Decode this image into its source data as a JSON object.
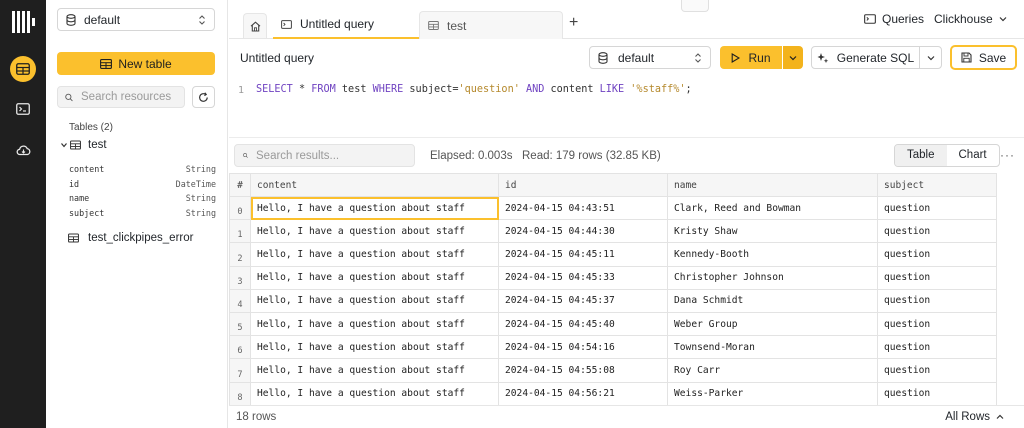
{
  "rail": {
    "items": [
      {
        "name": "table-view",
        "icon": "table-icon",
        "active": true
      },
      {
        "name": "queries",
        "icon": "terminal-icon",
        "active": false
      },
      {
        "name": "services",
        "icon": "cloud-icon",
        "active": false
      }
    ]
  },
  "sidebar": {
    "database": "default",
    "new_table_label": "New table",
    "search_placeholder": "Search resources",
    "tables_heading": "Tables (2)",
    "tables": [
      {
        "name": "test",
        "expanded": true,
        "columns": [
          {
            "name": "content",
            "type": "String"
          },
          {
            "name": "id",
            "type": "DateTime"
          },
          {
            "name": "name",
            "type": "String"
          },
          {
            "name": "subject",
            "type": "String"
          }
        ]
      },
      {
        "name": "test_clickpipes_error",
        "expanded": false
      }
    ]
  },
  "tabs": [
    {
      "label": "Untitled query",
      "active": true,
      "unsaved": true
    },
    {
      "label": "test",
      "active": false
    }
  ],
  "topbar": {
    "queries_label": "Queries",
    "service_label": "Clickhouse"
  },
  "query": {
    "title": "Untitled query",
    "database": "default",
    "run_label": "Run",
    "generate_sql_label": "Generate SQL",
    "save_label": "Save",
    "line_number": "1",
    "sql": "SELECT * FROM test WHERE subject='question' AND content LIKE '%staff%';"
  },
  "results": {
    "search_placeholder": "Search results...",
    "elapsed": "Elapsed: 0.003s",
    "read": "Read: 179 rows (32.85 KB)",
    "view_table": "Table",
    "view_chart": "Chart",
    "more": "···",
    "columns": [
      "#",
      "content",
      "id",
      "name",
      "subject"
    ],
    "rows": [
      {
        "n": "0",
        "content": "Hello, I have a question about staff",
        "id": "2024-04-15 04:43:51",
        "name": "Clark, Reed and Bowman",
        "subject": "question"
      },
      {
        "n": "1",
        "content": "Hello, I have a question about staff",
        "id": "2024-04-15 04:44:30",
        "name": "Kristy Shaw",
        "subject": "question"
      },
      {
        "n": "2",
        "content": "Hello, I have a question about staff",
        "id": "2024-04-15 04:45:11",
        "name": "Kennedy-Booth",
        "subject": "question"
      },
      {
        "n": "3",
        "content": "Hello, I have a question about staff",
        "id": "2024-04-15 04:45:33",
        "name": "Christopher Johnson",
        "subject": "question"
      },
      {
        "n": "4",
        "content": "Hello, I have a question about staff",
        "id": "2024-04-15 04:45:37",
        "name": "Dana Schmidt",
        "subject": "question"
      },
      {
        "n": "5",
        "content": "Hello, I have a question about staff",
        "id": "2024-04-15 04:45:40",
        "name": "Weber Group",
        "subject": "question"
      },
      {
        "n": "6",
        "content": "Hello, I have a question about staff",
        "id": "2024-04-15 04:54:16",
        "name": "Townsend-Moran",
        "subject": "question"
      },
      {
        "n": "7",
        "content": "Hello, I have a question about staff",
        "id": "2024-04-15 04:55:08",
        "name": "Roy Carr",
        "subject": "question"
      },
      {
        "n": "8",
        "content": "Hello, I have a question about staff",
        "id": "2024-04-15 04:56:21",
        "name": "Weiss-Parker",
        "subject": "question"
      }
    ],
    "row_count": "18 rows",
    "all_rows_label": "All Rows"
  },
  "colors": {
    "accent": "#fbc02d",
    "rail_bg": "#1f1f1f",
    "keyword": "#6f42c1",
    "string": "#b5892c"
  }
}
